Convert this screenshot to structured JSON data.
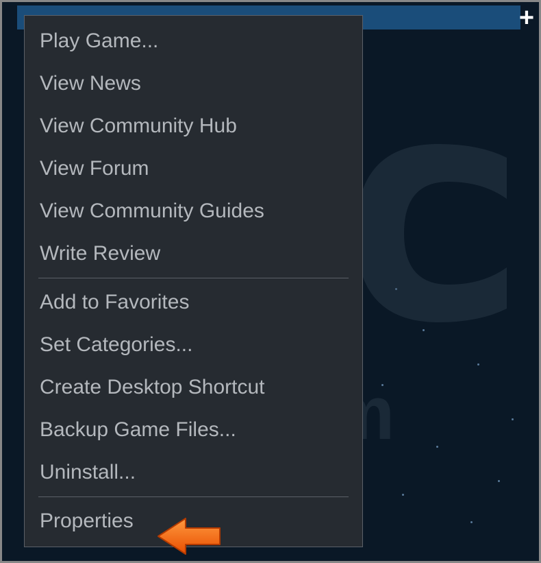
{
  "selected_item_prefix": "",
  "plus_glyph": "+",
  "menu": {
    "group1": [
      "Play Game...",
      "View News",
      "View Community Hub",
      "View Forum",
      "View Community Guides",
      "Write Review"
    ],
    "group2": [
      "Add to Favorites",
      "Set Categories...",
      "Create Desktop Shortcut",
      "Backup Game Files...",
      "Uninstall..."
    ],
    "group3": [
      "Properties"
    ]
  },
  "watermark_text": "PCrisk.com",
  "arrow_color": "#ff6a00"
}
